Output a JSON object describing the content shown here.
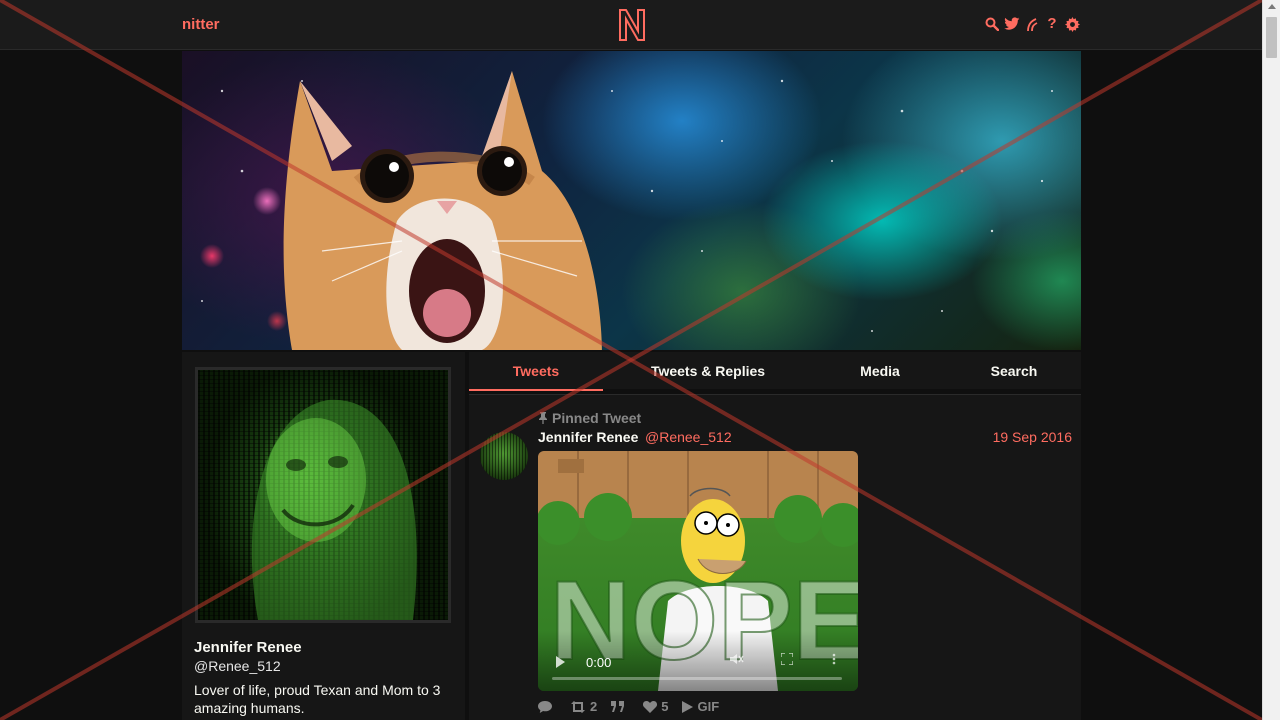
{
  "nav": {
    "brand": "nitter",
    "logo_letter": "N",
    "icons": [
      "search-icon",
      "twitter-bird-icon",
      "rss-icon",
      "help-icon",
      "settings-gear-icon"
    ],
    "help_glyph": "?"
  },
  "profile": {
    "name": "Jennifer Renee",
    "handle": "@Renee_512",
    "bio": "Lover of life, proud Texan and Mom to 3 amazing humans."
  },
  "tabs": [
    {
      "label": "Tweets",
      "active": true
    },
    {
      "label": "Tweets & Replies",
      "active": false
    },
    {
      "label": "Media",
      "active": false
    },
    {
      "label": "Search",
      "active": false
    }
  ],
  "tweet": {
    "pinned_label": "Pinned Tweet",
    "author_name": "Jennifer Renee",
    "author_handle": "@Renee_512",
    "date": "19 Sep 2016",
    "media": {
      "type": "gif",
      "overlay_text": "NOPE",
      "time": "0:00"
    },
    "stats": {
      "replies": "",
      "retweets": "2",
      "quotes": "",
      "likes": "5",
      "gif_label": "GIF"
    }
  },
  "colors": {
    "accent": "#ff6c60",
    "background": "#0f0f0f",
    "panel": "#161616",
    "overlay_x": "#c0392b"
  }
}
